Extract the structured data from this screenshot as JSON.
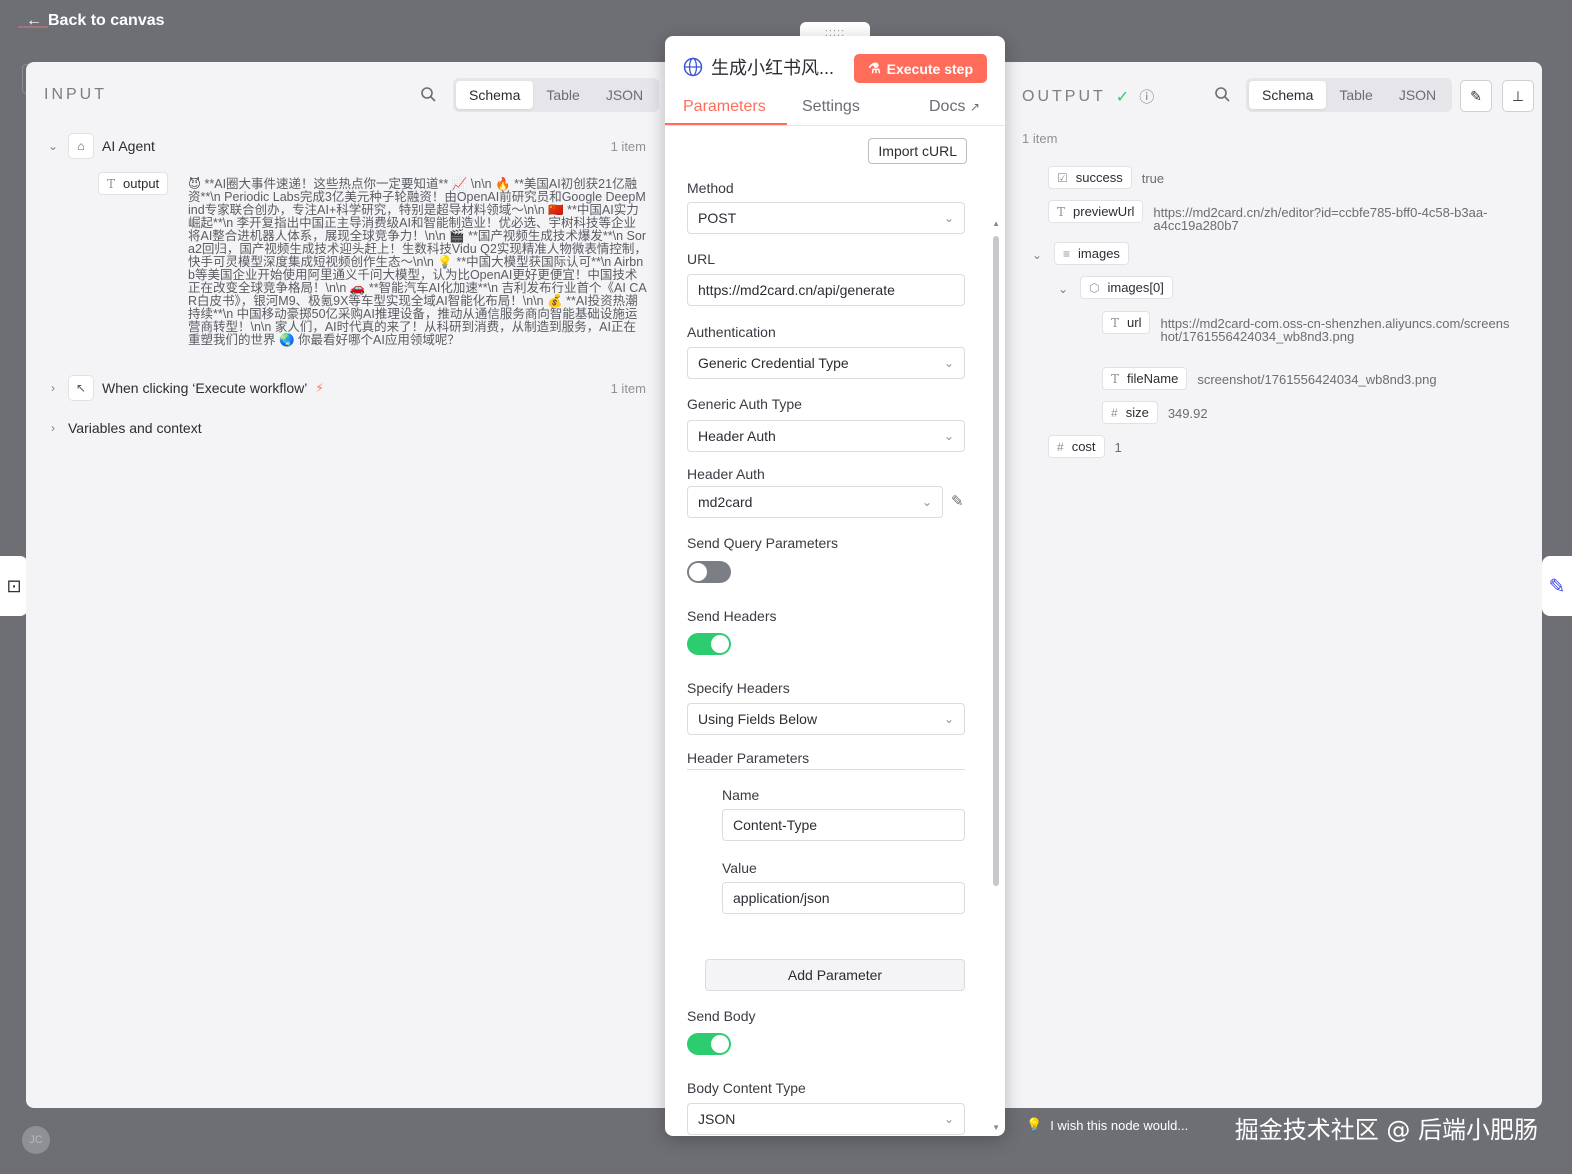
{
  "topbar": {
    "back_label": "Back to canvas"
  },
  "input": {
    "label": "INPUT",
    "views": [
      "Schema",
      "Table",
      "JSON"
    ],
    "active_view": "Schema",
    "ai_agent": {
      "label": "AI Agent",
      "count": "1 item"
    },
    "output_field": "output",
    "output_text": "😈 **AI圈大事件速递！这些热点你一定要知道** 📈 \\n\\n 🔥 **美国AI初创获21亿融资**\\n Periodic Labs完成3亿美元种子轮融资！由OpenAI前研究员和Google DeepMind专家联合创办，专注AI+科学研究，特别是超导材料领域～\\n\\n 🇨🇳 **中国AI实力崛起**\\n 李开复指出中国正主导消费级AI和智能制造业！优必选、宇树科技等企业将AI整合进机器人体系，展现全球竞争力！\\n\\n 🎬 **国产视频生成技术爆发**\\n Sora2回归，国产视频生成技术迎头赶上！生数科技Vidu Q2实现精准人物微表情控制，快手可灵模型深度集成短视频创作生态～\\n\\n 💡 **中国大模型获国际认可**\\n Airbnb等美国企业开始使用阿里通义千问大模型，认为比OpenAI更好更便宜！中国技术正在改变全球竞争格局！\\n\\n 🚗 **智能汽车AI化加速**\\n 吉利发布行业首个《AI CAR白皮书》，银河M9、极氪9X等车型实现全域AI智能化布局！\\n\\n 💰 **AI投资热潮持续**\\n 中国移动豪掷50亿采购AI推理设备，推动从通信服务商向智能基础设施运营商转型！\\n\\n 家人们，AI时代真的来了！从科研到消费，从制造到服务，AI正在重塑我们的世界 🌏 你最看好哪个AI应用领域呢？",
    "trigger": {
      "label": "When clicking ‘Execute workflow’",
      "count": "1 item"
    },
    "variables_label": "Variables and context"
  },
  "params": {
    "title": "生成小红书风...",
    "execute_label": "Execute step",
    "tabs": {
      "parameters": "Parameters",
      "settings": "Settings",
      "docs": "Docs"
    },
    "import_curl": "Import cURL",
    "method": {
      "label": "Method",
      "value": "POST"
    },
    "url": {
      "label": "URL",
      "value": "https://md2card.cn/api/generate"
    },
    "auth": {
      "label": "Authentication",
      "value": "Generic Credential Type"
    },
    "generic_auth": {
      "label": "Generic Auth Type",
      "value": "Header Auth"
    },
    "header_auth": {
      "label": "Header Auth",
      "value": "md2card"
    },
    "send_query": {
      "label": "Send Query Parameters",
      "enabled": false
    },
    "send_headers": {
      "label": "Send Headers",
      "enabled": true
    },
    "specify_headers": {
      "label": "Specify Headers",
      "value": "Using Fields Below"
    },
    "header_params": {
      "label": "Header Parameters",
      "name_label": "Name",
      "name_value": "Content-Type",
      "value_label": "Value",
      "value_value": "application/json",
      "add_label": "Add Parameter"
    },
    "send_body": {
      "label": "Send Body",
      "enabled": true
    },
    "body_content_type": {
      "label": "Body Content Type",
      "value": "JSON"
    }
  },
  "output": {
    "label": "OUTPUT",
    "views": [
      "Schema",
      "Table",
      "JSON"
    ],
    "active_view": "Schema",
    "count": "1 item",
    "success": {
      "key": "success",
      "value": "true"
    },
    "previewUrl": {
      "key": "previewUrl",
      "value": "https://md2card.cn/zh/editor?id=ccbfe785-bff0-4c58-b3aa-a4cc19a280b7"
    },
    "images": {
      "key": "images",
      "item": "images[0]"
    },
    "url": {
      "key": "url",
      "value": "https://md2card-com.oss-cn-shenzhen.aliyuncs.com/screenshot/1761556424034_wb8nd3.png"
    },
    "fileName": {
      "key": "fileName",
      "value": "screenshot/1761556424034_wb8nd3.png"
    },
    "size": {
      "key": "size",
      "value": "349.92"
    },
    "cost": {
      "key": "cost",
      "value": "1"
    }
  },
  "footer": {
    "feedback": "I wish this node would...",
    "watermark": "掘金技术社区 @ 后端小肥肠"
  },
  "colors": {
    "accent": "#ff6d5a",
    "toggle_on": "#2ecc71",
    "success": "#2ecc71"
  }
}
